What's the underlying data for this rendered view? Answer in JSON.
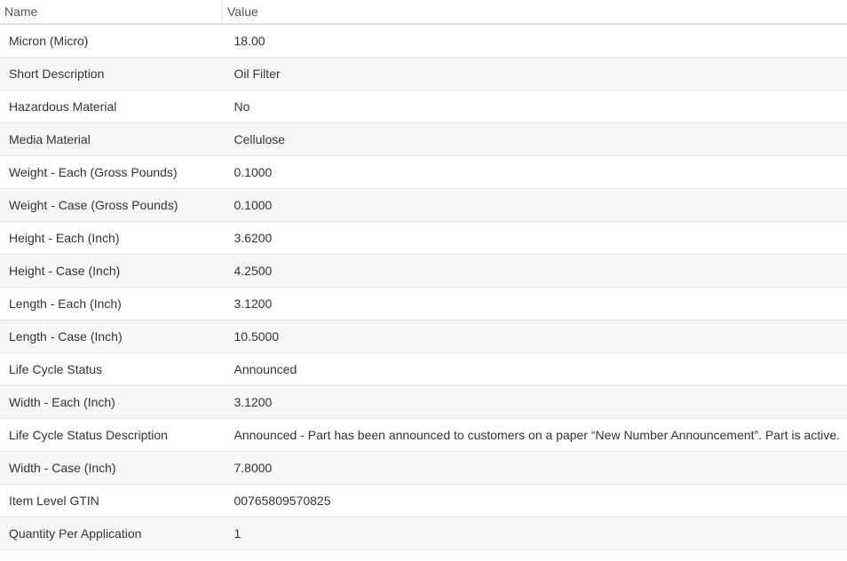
{
  "table": {
    "headers": {
      "name": "Name",
      "value": "Value"
    },
    "rows": [
      {
        "name": "Micron (Micro)",
        "value": "18.00"
      },
      {
        "name": "Short Description",
        "value": "Oil Filter"
      },
      {
        "name": "Hazardous Material",
        "value": "No"
      },
      {
        "name": "Media Material",
        "value": "Cellulose"
      },
      {
        "name": "Weight - Each (Gross Pounds)",
        "value": "0.1000"
      },
      {
        "name": "Weight - Case (Gross Pounds)",
        "value": "0.1000"
      },
      {
        "name": "Height - Each (Inch)",
        "value": "3.6200"
      },
      {
        "name": "Height - Case (Inch)",
        "value": "4.2500"
      },
      {
        "name": "Length - Each (Inch)",
        "value": "3.1200"
      },
      {
        "name": "Length - Case (Inch)",
        "value": "10.5000"
      },
      {
        "name": "Life Cycle Status",
        "value": "Announced"
      },
      {
        "name": "Width - Each (Inch)",
        "value": "3.1200"
      },
      {
        "name": "Life Cycle Status Description",
        "value": "Announced - Part has been announced to customers on a paper “New Number Announcement”. Part is active."
      },
      {
        "name": "Width - Case (Inch)",
        "value": "7.8000"
      },
      {
        "name": "Item Level GTIN",
        "value": "00765809570825"
      },
      {
        "name": "Quantity Per Application",
        "value": "1"
      }
    ]
  }
}
